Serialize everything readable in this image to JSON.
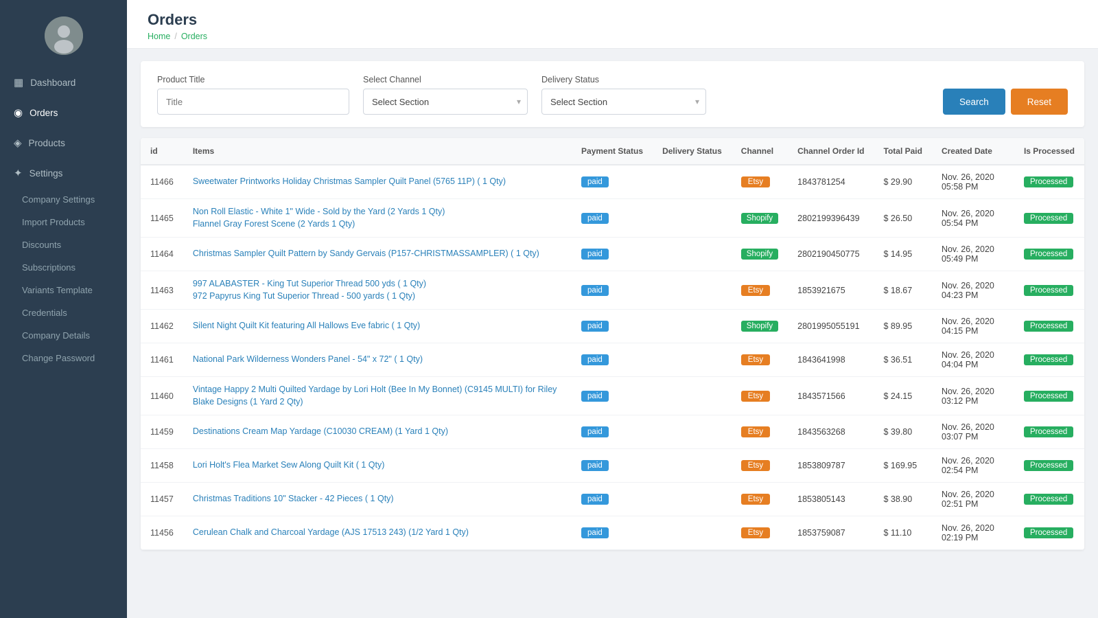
{
  "sidebar": {
    "nav_items": [
      {
        "id": "dashboard",
        "label": "Dashboard",
        "icon": "▦",
        "active": false
      },
      {
        "id": "orders",
        "label": "Orders",
        "icon": "◉",
        "active": true
      },
      {
        "id": "products",
        "label": "Products",
        "icon": "◈",
        "active": false
      },
      {
        "id": "settings",
        "label": "Settings",
        "icon": "✦",
        "active": false
      }
    ],
    "settings_sub": [
      {
        "id": "company-settings",
        "label": "Company Settings"
      },
      {
        "id": "import-products",
        "label": "Import Products"
      },
      {
        "id": "discounts",
        "label": "Discounts"
      },
      {
        "id": "subscriptions",
        "label": "Subscriptions"
      },
      {
        "id": "variants-template",
        "label": "Variants Template"
      },
      {
        "id": "credentials",
        "label": "Credentials"
      },
      {
        "id": "company-details",
        "label": "Company Details"
      },
      {
        "id": "change-password",
        "label": "Change Password"
      }
    ]
  },
  "page": {
    "title": "Orders",
    "breadcrumb_home": "Home",
    "breadcrumb_current": "Orders"
  },
  "filters": {
    "product_title_label": "Product Title",
    "product_title_placeholder": "Title",
    "channel_label": "Select Channel",
    "channel_placeholder": "Select Section",
    "delivery_label": "Delivery Status",
    "delivery_placeholder": "Select Section",
    "search_btn": "Search",
    "reset_btn": "Reset"
  },
  "table": {
    "columns": {
      "id": "id",
      "items": "Items",
      "payment_status": "Payment Status",
      "delivery_status": "Delivery Status",
      "channel": "Channel",
      "channel_order_id": "Channel Order Id",
      "total_paid": "Total Paid",
      "created_date": "Created Date",
      "is_processed": "Is Processed"
    },
    "rows": [
      {
        "id": "11466",
        "items": [
          "Sweetwater Printworks Holiday Christmas Sampler Quilt Panel (5765 11P) ( 1 Qty)"
        ],
        "payment_status": "paid",
        "delivery_status": "",
        "channel": "Etsy",
        "channel_order_id": "1843781254",
        "total_paid": "$ 29.90",
        "created_date": "Nov. 26, 2020 05:58 PM",
        "is_processed": "Processed"
      },
      {
        "id": "11465",
        "items": [
          "Non Roll Elastic - White 1\" Wide - Sold by the Yard (2 Yards 1 Qty)",
          "Flannel Gray Forest Scene (2 Yards 1 Qty)"
        ],
        "payment_status": "paid",
        "delivery_status": "",
        "channel": "Shopify",
        "channel_order_id": "2802199396439",
        "total_paid": "$ 26.50",
        "created_date": "Nov. 26, 2020 05:54 PM",
        "is_processed": "Processed"
      },
      {
        "id": "11464",
        "items": [
          "Christmas Sampler Quilt Pattern by Sandy Gervais (P157-CHRISTMASSAMPLER) ( 1 Qty)"
        ],
        "payment_status": "paid",
        "delivery_status": "",
        "channel": "Shopify",
        "channel_order_id": "2802190450775",
        "total_paid": "$ 14.95",
        "created_date": "Nov. 26, 2020 05:49 PM",
        "is_processed": "Processed"
      },
      {
        "id": "11463",
        "items": [
          "997 ALABASTER - King Tut Superior Thread 500 yds ( 1 Qty)",
          "972 Papyrus King Tut Superior Thread - 500 yards ( 1 Qty)"
        ],
        "payment_status": "paid",
        "delivery_status": "",
        "channel": "Etsy",
        "channel_order_id": "1853921675",
        "total_paid": "$ 18.67",
        "created_date": "Nov. 26, 2020 04:23 PM",
        "is_processed": "Processed"
      },
      {
        "id": "11462",
        "items": [
          "Silent Night Quilt Kit featuring All Hallows Eve fabric ( 1 Qty)"
        ],
        "payment_status": "paid",
        "delivery_status": "",
        "channel": "Shopify",
        "channel_order_id": "2801995055191",
        "total_paid": "$ 89.95",
        "created_date": "Nov. 26, 2020 04:15 PM",
        "is_processed": "Processed"
      },
      {
        "id": "11461",
        "items": [
          "National Park Wilderness Wonders Panel - 54\" x 72\" ( 1 Qty)"
        ],
        "payment_status": "paid",
        "delivery_status": "",
        "channel": "Etsy",
        "channel_order_id": "1843641998",
        "total_paid": "$ 36.51",
        "created_date": "Nov. 26, 2020 04:04 PM",
        "is_processed": "Processed"
      },
      {
        "id": "11460",
        "items": [
          "Vintage Happy 2 Multi Quilted Yardage by Lori Holt (Bee In My Bonnet) (C9145 MULTI) for Riley Blake Designs (1 Yard 2 Qty)"
        ],
        "payment_status": "paid",
        "delivery_status": "",
        "channel": "Etsy",
        "channel_order_id": "1843571566",
        "total_paid": "$ 24.15",
        "created_date": "Nov. 26, 2020 03:12 PM",
        "is_processed": "Processed"
      },
      {
        "id": "11459",
        "items": [
          "Destinations Cream Map Yardage (C10030 CREAM) (1 Yard 1 Qty)"
        ],
        "payment_status": "paid",
        "delivery_status": "",
        "channel": "Etsy",
        "channel_order_id": "1843563268",
        "total_paid": "$ 39.80",
        "created_date": "Nov. 26, 2020 03:07 PM",
        "is_processed": "Processed"
      },
      {
        "id": "11458",
        "items": [
          "Lori Holt's Flea Market Sew Along Quilt Kit ( 1 Qty)"
        ],
        "payment_status": "paid",
        "delivery_status": "",
        "channel": "Etsy",
        "channel_order_id": "1853809787",
        "total_paid": "$ 169.95",
        "created_date": "Nov. 26, 2020 02:54 PM",
        "is_processed": "Processed"
      },
      {
        "id": "11457",
        "items": [
          "Christmas Traditions 10\" Stacker - 42 Pieces ( 1 Qty)"
        ],
        "payment_status": "paid",
        "delivery_status": "",
        "channel": "Etsy",
        "channel_order_id": "1853805143",
        "total_paid": "$ 38.90",
        "created_date": "Nov. 26, 2020 02:51 PM",
        "is_processed": "Processed"
      },
      {
        "id": "11456",
        "items": [
          "Cerulean Chalk and Charcoal Yardage (AJS 17513 243) (1/2 Yard 1 Qty)"
        ],
        "payment_status": "paid",
        "delivery_status": "",
        "channel": "Etsy",
        "channel_order_id": "1853759087",
        "total_paid": "$ 11.10",
        "created_date": "Nov. 26, 2020 02:19 PM",
        "is_processed": "Processed"
      }
    ]
  }
}
